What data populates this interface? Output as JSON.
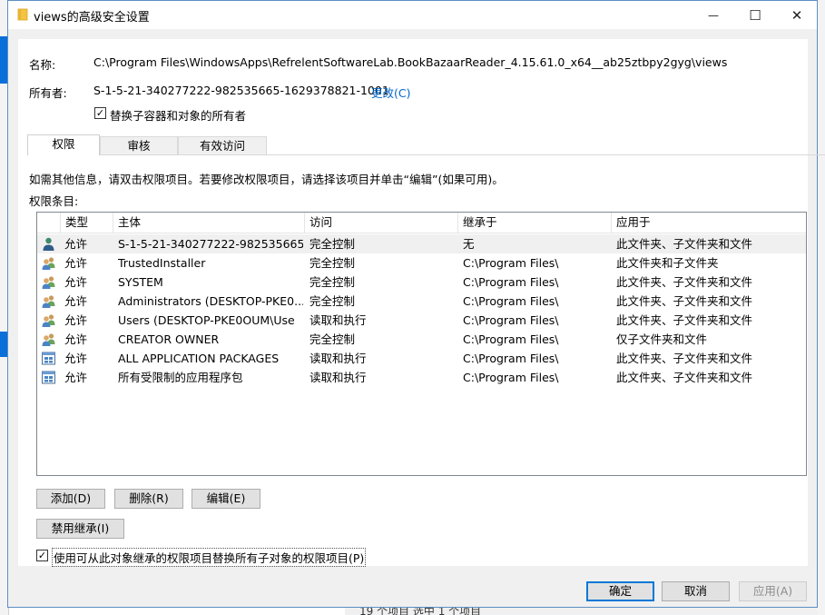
{
  "window": {
    "title": "views的高级安全设置",
    "minimize": "—",
    "maximize": "☐",
    "close": "✕"
  },
  "info": {
    "name_label": "名称:",
    "name_value": "C:\\Program Files\\WindowsApps\\RefrelentSoftwareLab.BookBazaarReader_4.15.61.0_x64__ab25ztbpy2gyg\\views",
    "owner_label": "所有者:",
    "owner_value": "S-1-5-21-340277222-982535665-1629378821-1001",
    "owner_change": "更改(C)",
    "replace_owner_label": "替换子容器和对象的所有者",
    "replace_owner_checked": true
  },
  "tabs": [
    {
      "label": "权限",
      "active": true
    },
    {
      "label": "审核",
      "active": false
    },
    {
      "label": "有效访问",
      "active": false
    }
  ],
  "hint": "如需其他信息，请双击权限项目。若要修改权限项目，请选择该项目并单击“编辑”(如果可用)。",
  "entries_label": "权限条目:",
  "table": {
    "columns": [
      "类型",
      "主体",
      "访问",
      "继承于",
      "应用于"
    ],
    "rows": [
      {
        "icon": "user-icon",
        "type": "允许",
        "principal": "S-1-5-21-340277222-982535665...",
        "access": "完全控制",
        "inherited": "无",
        "applies": "此文件夹、子文件夹和文件",
        "selected": true
      },
      {
        "icon": "group-icon",
        "type": "允许",
        "principal": "TrustedInstaller",
        "access": "完全控制",
        "inherited": "C:\\Program Files\\",
        "applies": "此文件夹和子文件夹",
        "selected": false
      },
      {
        "icon": "group-icon",
        "type": "允许",
        "principal": "SYSTEM",
        "access": "完全控制",
        "inherited": "C:\\Program Files\\",
        "applies": "此文件夹、子文件夹和文件",
        "selected": false
      },
      {
        "icon": "group-icon",
        "type": "允许",
        "principal": "Administrators (DESKTOP-PKE0...",
        "access": "完全控制",
        "inherited": "C:\\Program Files\\",
        "applies": "此文件夹、子文件夹和文件",
        "selected": false
      },
      {
        "icon": "group-icon",
        "type": "允许",
        "principal": "Users (DESKTOP-PKE0OUM\\Use",
        "access": "读取和执行",
        "inherited": "C:\\Program Files\\",
        "applies": "此文件夹、子文件夹和文件",
        "selected": false
      },
      {
        "icon": "group-icon",
        "type": "允许",
        "principal": "CREATOR OWNER",
        "access": "完全控制",
        "inherited": "C:\\Program Files\\",
        "applies": "仅子文件夹和文件",
        "selected": false
      },
      {
        "icon": "package-icon",
        "type": "允许",
        "principal": "ALL APPLICATION PACKAGES",
        "access": "读取和执行",
        "inherited": "C:\\Program Files\\",
        "applies": "此文件夹、子文件夹和文件",
        "selected": false
      },
      {
        "icon": "package-icon",
        "type": "允许",
        "principal": "所有受限制的应用程序包",
        "access": "读取和执行",
        "inherited": "C:\\Program Files\\",
        "applies": "此文件夹、子文件夹和文件",
        "selected": false
      }
    ]
  },
  "buttons": {
    "add": "添加(D)",
    "remove": "删除(R)",
    "edit": "编辑(E)",
    "disable_inheritance": "禁用继承(I)",
    "ok": "确定",
    "cancel": "取消",
    "apply": "应用(A)"
  },
  "replace_child": {
    "label": "使用可从此对象继承的权限项目替换所有子对象的权限项目(P)",
    "checked": true
  },
  "background": {
    "status_text": "19 个项目    选中 1 个项目"
  }
}
